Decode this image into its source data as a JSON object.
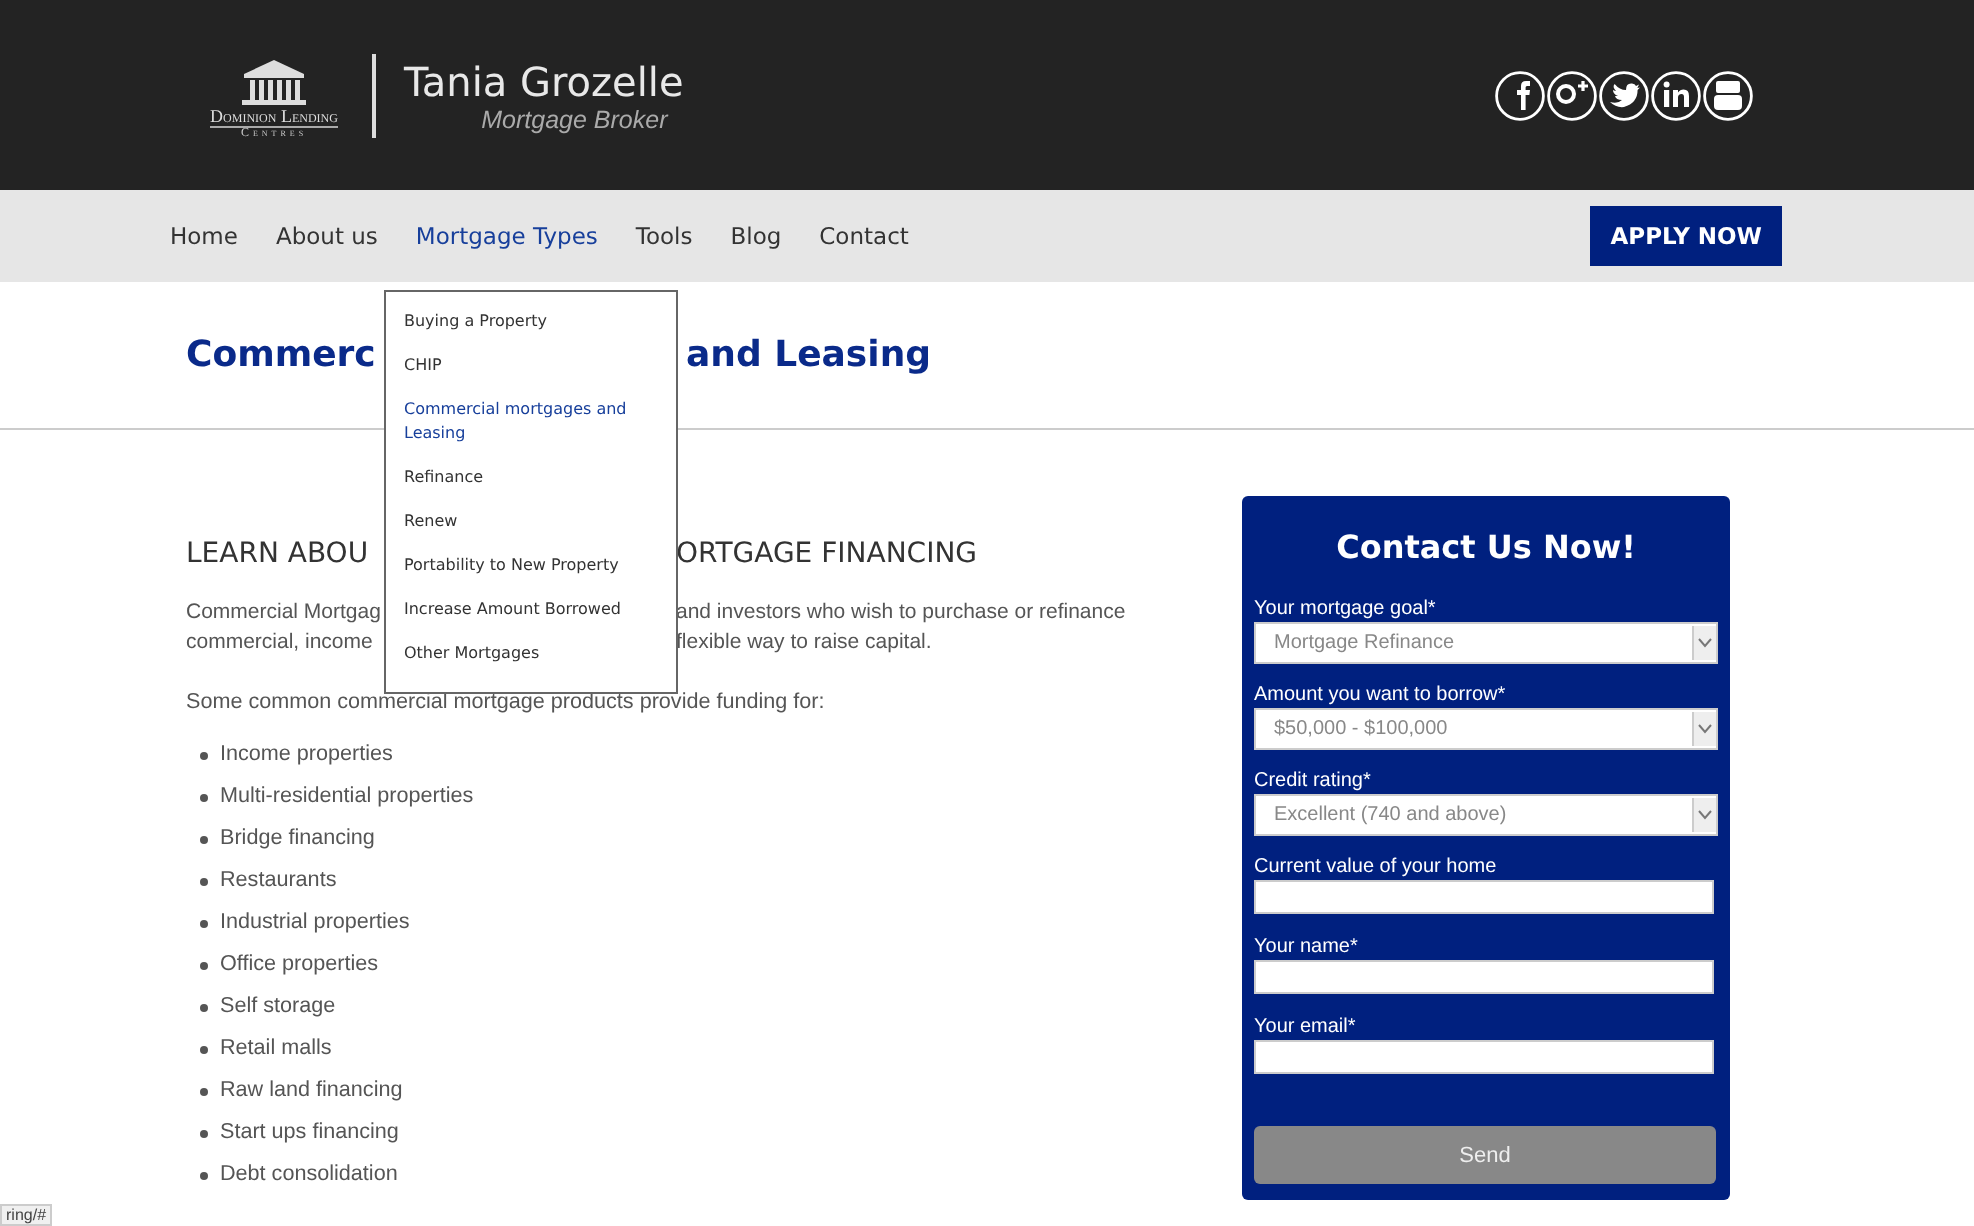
{
  "header": {
    "logo_name": "Dominion Lending",
    "logo_sub": "Centres",
    "broker_name": "Tania Grozelle",
    "broker_title": "Mortgage Broker"
  },
  "nav": {
    "items": [
      {
        "label": "Home",
        "selected": false
      },
      {
        "label": "About us",
        "selected": false
      },
      {
        "label": "Mortgage Types",
        "selected": true
      },
      {
        "label": "Tools",
        "selected": false
      },
      {
        "label": "Blog",
        "selected": false
      },
      {
        "label": "Contact",
        "selected": false
      }
    ],
    "apply_button": "APPLY NOW"
  },
  "dropdown": [
    {
      "label": "Buying a Property",
      "selected": false
    },
    {
      "label": "CHIP",
      "selected": false
    },
    {
      "label": "Commercial mortgages and Leasing",
      "selected": true
    },
    {
      "label": "Refinance",
      "selected": false
    },
    {
      "label": "Renew",
      "selected": false
    },
    {
      "label": "Portability to New Property",
      "selected": false
    },
    {
      "label": "Increase Amount Borrowed",
      "selected": false
    },
    {
      "label": "Other Mortgages",
      "selected": false
    }
  ],
  "page_title": {
    "left": "Commerc",
    "right": "and Leasing"
  },
  "article": {
    "heading": {
      "left": "LEARN ABOU",
      "right": "ORTGAGE FINANCING"
    },
    "intro_lines": [
      {
        "left": "Commercial Mortgag",
        "right": "and investors who wish to purchase or refinance"
      },
      {
        "left": "commercial, income",
        "right": "flexible way to raise capital."
      }
    ],
    "lead": "Some common commercial mortgage products provide funding for:",
    "list": [
      "Income properties",
      "Multi-residential properties",
      "Bridge financing",
      "Restaurants",
      "Industrial properties",
      "Office properties",
      "Self storage",
      "Retail malls",
      "Raw land financing",
      "Start ups financing",
      "Debt consolidation"
    ]
  },
  "contact_form": {
    "title": "Contact Us Now!",
    "fields": [
      {
        "kind": "select",
        "label": "Your mortgage goal*",
        "value": "Mortgage Refinance"
      },
      {
        "kind": "select",
        "label": "Amount you want to borrow*",
        "value": "$50,000 - $100,000"
      },
      {
        "kind": "select",
        "label": "Credit rating*",
        "value": "Excellent (740 and above)"
      },
      {
        "kind": "text",
        "label": "Current value of your home"
      },
      {
        "kind": "text",
        "label": "Your name*"
      },
      {
        "kind": "text",
        "label": "Your email*"
      }
    ],
    "submit": "Send"
  },
  "status_bar": "ring/#"
}
